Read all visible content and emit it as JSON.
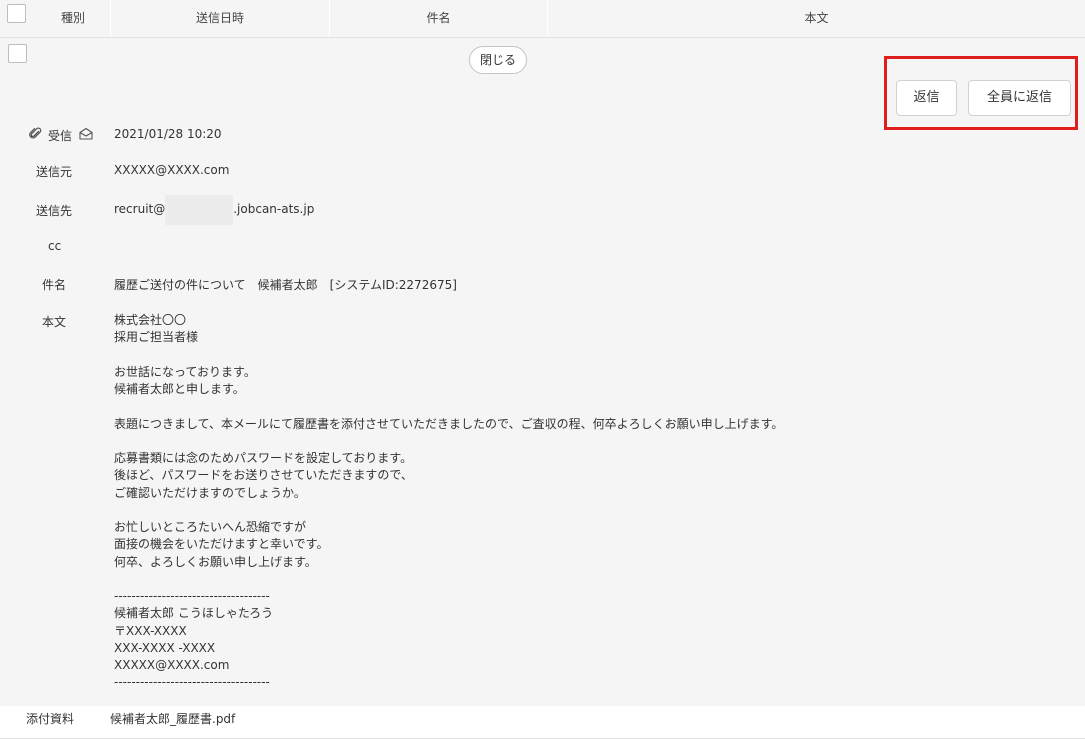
{
  "header": {
    "columns": [
      "種別",
      "送信日時",
      "件名",
      "本文"
    ]
  },
  "detail": {
    "close_label": "閉じる",
    "reply_label": "返信",
    "reply_all_label": "全員に返信",
    "type_label": "受信",
    "datetime": "2021/01/28 10:20",
    "from_label": "送信元",
    "from_value": "XXXXX@XXXX.com",
    "to_label": "送信先",
    "to_value_prefix": "recruit@",
    "to_value_suffix": ".jobcan-ats.jp",
    "cc_label": "cc",
    "subject_label": "件名",
    "subject_value": "履歴ご送付の件について　候補者太郎　[システムID:2272675]",
    "body_label": "本文",
    "body_lines": [
      "株式会社〇〇",
      "採用ご担当者様",
      "",
      "お世話になっております。",
      "候補者太郎と申します。",
      "",
      "表題につきまして、本メールにて履歴書を添付させていただきましたので、ご査収の程、何卒よろしくお願い申し上げます。",
      "",
      "応募書類には念のためパスワードを設定しております。",
      "後ほど、パスワードをお送りさせていただきますので、",
      "ご確認いただけますのでしょうか。",
      "",
      "お忙しいところたいへん恐縮ですが",
      "面接の機会をいただけますと幸いです。",
      "何卒、よろしくお願い申し上げます。",
      "",
      "------------------------------------",
      "候補者太郎 こうほしゃたろう",
      "〒XXX-XXXX",
      "XXX-XXXX -XXXX",
      "XXXXX@XXXX.com",
      "------------------------------------"
    ]
  },
  "attachments": {
    "label": "添付資料",
    "file_name": "候補者太郎_履歴書.pdf"
  },
  "colors": {
    "highlight": "#e01e1e",
    "panel_bg": "#f5f5f5"
  },
  "icons": [
    "paperclip-icon",
    "envelope-open-icon",
    "checkbox-icon"
  ]
}
